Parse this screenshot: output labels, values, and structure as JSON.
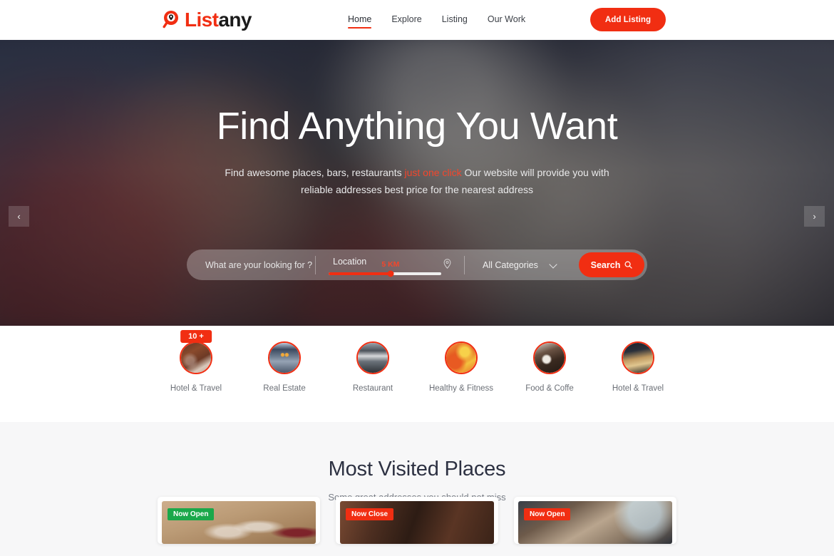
{
  "header": {
    "logo": {
      "part_red": "List",
      "part_dark": "any",
      "icon": "map-pin-search-icon"
    },
    "nav": [
      {
        "label": "Home",
        "active": true
      },
      {
        "label": "Explore",
        "active": false
      },
      {
        "label": "Listing",
        "active": false
      },
      {
        "label": "Our Work",
        "active": false
      }
    ],
    "cta": {
      "label": "Add Listing"
    }
  },
  "hero": {
    "title": "Find Anything You Want",
    "subtitle_part1": "Find awesome places, bars, restaurants ",
    "subtitle_highlight": "just one click",
    "subtitle_part2": " Our website will provide you with reliable addresses best price for the nearest address",
    "prev_arrow": "‹",
    "next_arrow": "›"
  },
  "search": {
    "keyword_placeholder": "What are your looking for ?",
    "location_label": "Location",
    "radius_value": "5 KM",
    "radius_percent": 55,
    "category_selected": "All Categories",
    "category_options": [
      "All Categories",
      "Hotel & Travel",
      "Real Estate",
      "Restaurant",
      "Healthy & Fitness",
      "Food & Coffe"
    ],
    "button_label": "Search",
    "button_icon": "magnifier-icon",
    "pin_icon": "location-pin-icon",
    "caret_icon": "chevron-down-icon"
  },
  "categories": {
    "items": [
      {
        "label": "Hotel & Travel",
        "badge": "10 +",
        "thumb": "img-hotel1"
      },
      {
        "label": "Real Estate",
        "badge": null,
        "thumb": "img-realestate"
      },
      {
        "label": "Restaurant",
        "badge": null,
        "thumb": "img-restaurant"
      },
      {
        "label": "Healthy & Fitness",
        "badge": null,
        "thumb": "img-healthy"
      },
      {
        "label": "Food & Coffe",
        "badge": null,
        "thumb": "img-food"
      },
      {
        "label": "Hotel & Travel",
        "badge": null,
        "thumb": "img-hotel2"
      }
    ]
  },
  "visited": {
    "title": "Most Visited Places",
    "subtitle": "Some great addresses you should not miss",
    "cards": [
      {
        "badge": "Now Open",
        "badge_color": "#1aa84a",
        "media": "media-wine"
      },
      {
        "badge": "Now Close",
        "badge_color": "#f12e12",
        "media": "media-dark"
      },
      {
        "badge": "Now Open",
        "badge_color": "#f12e12",
        "media": "media-bar"
      }
    ]
  },
  "colors": {
    "brand_red": "#f12e12",
    "open_green": "#1aa84a",
    "section_bg": "#f7f7f8",
    "heading": "#2d3142"
  }
}
